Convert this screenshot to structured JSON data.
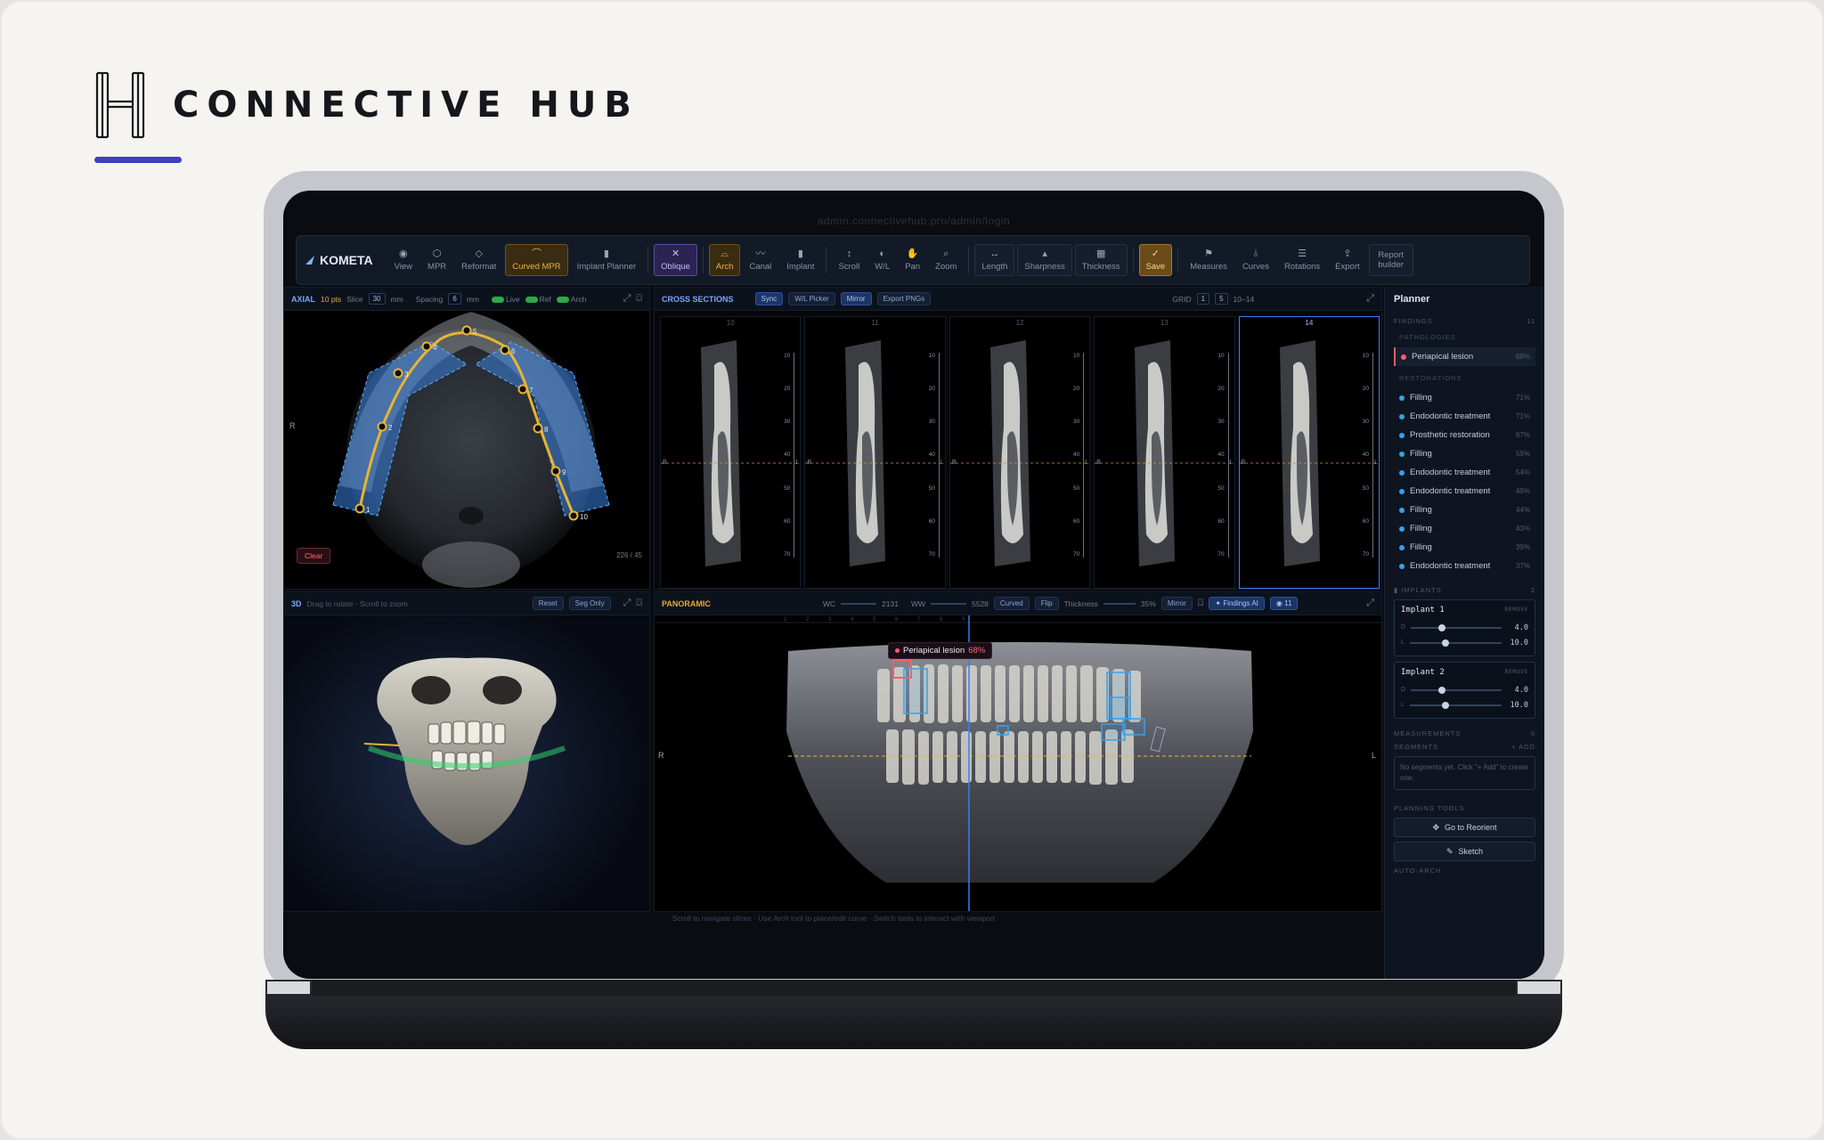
{
  "brand": {
    "name": "CONNECTIVE HUB"
  },
  "browser": {
    "url": "admin.connectivehub.pro/admin/login"
  },
  "app": {
    "logo": "KOMETA"
  },
  "toolbar": {
    "items": [
      {
        "label": "View",
        "icon": "eye-icon"
      },
      {
        "label": "MPR",
        "icon": "cube-icon"
      },
      {
        "label": "Reformat",
        "icon": "reformat-icon"
      },
      {
        "label": "Curved MPR",
        "icon": "curve-icon",
        "state": "active"
      },
      {
        "label": "Implant Planner",
        "icon": "implant-icon"
      },
      {
        "label": "Oblique",
        "icon": "x-icon",
        "state": "selected"
      },
      {
        "label": "Arch",
        "icon": "arch-icon",
        "state": "active"
      },
      {
        "label": "Canal",
        "icon": "canal-icon"
      },
      {
        "label": "Implant",
        "icon": "implant-icon"
      },
      {
        "label": "Scroll",
        "icon": "scroll-icon"
      },
      {
        "label": "W/L",
        "icon": "contrast-icon"
      },
      {
        "label": "Pan",
        "icon": "hand-icon"
      },
      {
        "label": "Zoom",
        "icon": "magnifier-icon"
      },
      {
        "label": "Length",
        "icon": "ruler-icon"
      },
      {
        "label": "Sharpness",
        "icon": "sharpness-icon"
      },
      {
        "label": "Thickness",
        "icon": "thickness-icon"
      },
      {
        "label": "Save",
        "icon": "check-icon",
        "state": "save"
      },
      {
        "label": "Measures",
        "icon": "flag-icon"
      },
      {
        "label": "Curves",
        "icon": "curves-icon"
      },
      {
        "label": "Rotations",
        "icon": "list-icon"
      },
      {
        "label": "Export",
        "icon": "upload-icon"
      },
      {
        "label": "Report builder",
        "icon": ""
      }
    ]
  },
  "axial": {
    "title": "AXIAL",
    "pts": "10 pts",
    "slice_label": "Slice",
    "slice_value": "30",
    "unit": "mm",
    "spacing_label": "Spacing",
    "spacing_value": "6",
    "toggles": [
      "Live",
      "Ref",
      "Arch"
    ],
    "side_label": "R",
    "clear": "Clear",
    "counter": "226 / 45",
    "points": [
      "1",
      "2",
      "3",
      "4",
      "5",
      "6",
      "7",
      "8",
      "9",
      "10"
    ]
  },
  "cross": {
    "title": "CROSS SECTIONS",
    "chips": [
      "Sync",
      "W/L Picker",
      "Mirror",
      "Export PNGs"
    ],
    "grid_label": "GRID",
    "grid_a": "1",
    "grid_b": "5",
    "range": "10–14",
    "slices": [
      "10",
      "11",
      "12",
      "13",
      "14"
    ],
    "ruler": [
      "10",
      "20",
      "30",
      "40",
      "50",
      "60",
      "70"
    ],
    "side_l": "B",
    "side_r": "L"
  },
  "view3d": {
    "title": "3D",
    "hint": "Drag to rotate · Scroll to zoom",
    "buttons": [
      "Reset",
      "Seg Only"
    ]
  },
  "panoramic": {
    "title": "PANORAMIC",
    "wc_label": "WC",
    "wc_value": "2131",
    "ww_label": "WW",
    "ww_value": "5528",
    "chips": [
      "Curved",
      "Flip",
      "Mirror"
    ],
    "thickness_label": "Thickness",
    "thickness_value": "35%",
    "findings_label": "Findings AI",
    "findings_count": "11",
    "lesion_label": "Periapical lesion",
    "lesion_pct": "68%",
    "side_l": "R",
    "side_r": "L"
  },
  "sidebar": {
    "title": "Planner",
    "findings_label": "FINDINGS",
    "findings_count": "11",
    "pathologies_label": "PATHOLOGIES",
    "pathologies": [
      {
        "name": "Periapical lesion",
        "pct": "68%"
      }
    ],
    "restorations_label": "RESTORATIONS",
    "restorations": [
      {
        "name": "Filling",
        "pct": "71%"
      },
      {
        "name": "Endodontic treatment",
        "pct": "71%"
      },
      {
        "name": "Prosthetic restoration",
        "pct": "67%"
      },
      {
        "name": "Filling",
        "pct": "59%"
      },
      {
        "name": "Endodontic treatment",
        "pct": "54%"
      },
      {
        "name": "Endodontic treatment",
        "pct": "49%"
      },
      {
        "name": "Filling",
        "pct": "44%"
      },
      {
        "name": "Filling",
        "pct": "43%"
      },
      {
        "name": "Filling",
        "pct": "39%"
      },
      {
        "name": "Endodontic treatment",
        "pct": "37%"
      }
    ],
    "implants_label": "IMPLANTS",
    "implants_count": "2",
    "implants": [
      {
        "name": "Implant 1",
        "remove": "REMOVE",
        "d_label": "D",
        "d": "4.0",
        "l_label": "L",
        "l": "10.0"
      },
      {
        "name": "Implant 2",
        "remove": "REMOVE",
        "d_label": "D",
        "d": "4.0",
        "l_label": "L",
        "l": "10.0"
      }
    ],
    "measurements_label": "MEASUREMENTS",
    "measurements_count": "0",
    "segments_label": "SEGMENTS",
    "segments_add": "+ ADD",
    "segments_empty": "No segments yet. Click \"+ Add\" to create one.",
    "planning_label": "PLANNING TOOLS",
    "reorient": "Go to Reorient",
    "sketch": "Sketch",
    "autoarch_label": "AUTO-ARCH"
  },
  "status": {
    "text": "Scroll to navigate slices · Use Arch tool to place/edit curve · Switch tools to interact with viewport"
  }
}
